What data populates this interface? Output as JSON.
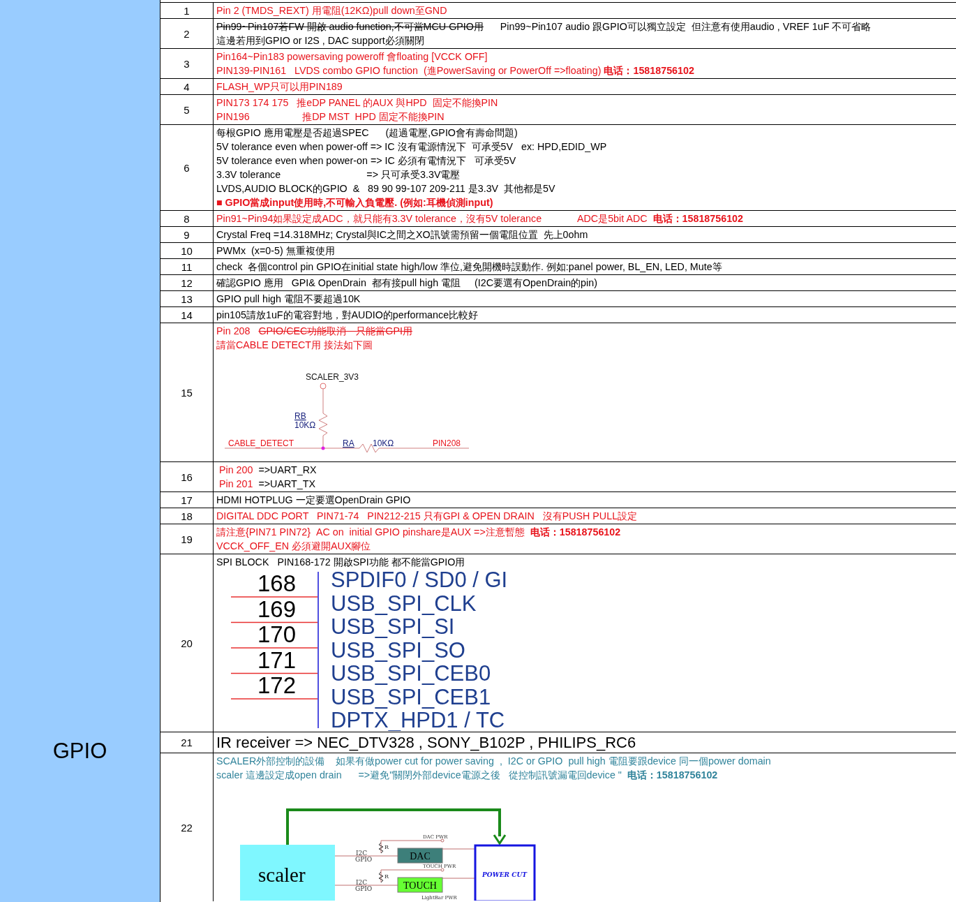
{
  "sidebar": {
    "label": "GPIO"
  },
  "rows": [
    {
      "no": "1",
      "kind": "text",
      "lines": [
        {
          "bold": false,
          "parts": [
            {
              "text": "Pin 2 (TMDS_REXT) 用電阻(12KΩ)pull down至GND",
              "color": "#e8141c",
              "struck": false
            }
          ]
        }
      ]
    },
    {
      "no": "2",
      "kind": "text",
      "lines": [
        {
          "bold": false,
          "parts": [
            {
              "text": "Pin99~Pin107若FW 開啟 audio function,不可當MCU GPIO用",
              "color": "#000000",
              "struck": true
            },
            {
              "text": "      Pin99~Pin107 audio 跟GPIO可以獨立設定  但注意有使用audio , VREF 1uF 不可省略",
              "color": "#000000",
              "struck": false
            }
          ]
        },
        {
          "bold": false,
          "parts": [
            {
              "text": "這邊若用到GPIO or I2S , DAC support必須關閉",
              "color": "#000000",
              "struck": false
            }
          ]
        }
      ]
    },
    {
      "no": "3",
      "kind": "text",
      "lines": [
        {
          "bold": false,
          "parts": [
            {
              "text": "Pin164~Pin183 powersaving poweroff 會floating [VCCK OFF]",
              "color": "#e8141c",
              "struck": false
            }
          ]
        },
        {
          "bold": false,
          "parts": [
            {
              "text": "PIN139-PIN161   LVDS combo GPIO function  (進PowerSaving or PowerOff =>floating) **电话：15818756102**",
              "color": "#e8141c",
              "struck": false
            }
          ]
        }
      ]
    },
    {
      "no": "4",
      "kind": "text",
      "lines": [
        {
          "bold": false,
          "parts": [
            {
              "text": "FLASH_WP只可以用PIN189",
              "color": "#e8141c",
              "struck": false
            }
          ]
        }
      ]
    },
    {
      "no": "5",
      "kind": "text",
      "lines": [
        {
          "bold": false,
          "parts": [
            {
              "text": "PIN173 174 175   推eDP PANEL 的AUX 與HPD  固定不能換PIN",
              "color": "#e8141c",
              "struck": false
            }
          ]
        },
        {
          "bold": false,
          "parts": [
            {
              "text": "PIN196                   推DP MST  HPD 固定不能換PIN",
              "color": "#e8141c",
              "struck": false
            }
          ]
        }
      ]
    },
    {
      "no": "6",
      "kind": "text",
      "lines": [
        {
          "bold": false,
          "parts": [
            {
              "text": "每根GPIO 應用電壓是否超過SPEC      (超過電壓,GPIO會有壽命問題)",
              "color": "#000000",
              "struck": false
            }
          ]
        },
        {
          "bold": false,
          "parts": [
            {
              "text": "5V tolerance even when power-off => IC 沒有電源情況下  可承受5V   ex: HPD,EDID_WP",
              "color": "#000000",
              "struck": false
            }
          ]
        },
        {
          "bold": false,
          "parts": [
            {
              "text": "5V tolerance even when power-on => IC 必須有電情況下   可承受5V",
              "color": "#000000",
              "struck": false
            }
          ]
        },
        {
          "bold": false,
          "parts": [
            {
              "text": "3.3V tolerance                               => 只可承受3.3V電壓",
              "color": "#000000",
              "struck": false
            }
          ]
        },
        {
          "bold": false,
          "parts": [
            {
              "text": "LVDS,AUDIO BLOCK的GPIO  &   89 90 99-107 209-211 是3.3V  其他都是5V",
              "color": "#000000",
              "struck": false
            }
          ]
        },
        {
          "bold": true,
          "parts": [
            {
              "text": "■ GPIO當成input使用時,不可輸入負電壓. (例如:耳機偵測input)",
              "color": "#e8141c",
              "struck": false
            }
          ]
        }
      ]
    },
    {
      "no": "8",
      "kind": "text",
      "lines": [
        {
          "bold": false,
          "parts": [
            {
              "text": "Pin91~Pin94如果設定成ADC，就只能有3.3V tolerance，沒有5V tolerance             ADC是5bit ADC  **电话：15818756102**",
              "color": "#e8141c",
              "struck": false
            }
          ]
        }
      ]
    },
    {
      "no": "9",
      "kind": "text",
      "lines": [
        {
          "bold": false,
          "parts": [
            {
              "text": "Crystal Freq =14.318MHz; Crystal與IC之間之XO訊號需預留一個電阻位置  先上0ohm",
              "color": "#000000",
              "struck": false
            }
          ]
        }
      ]
    },
    {
      "no": "10",
      "kind": "text",
      "lines": [
        {
          "bold": false,
          "parts": [
            {
              "text": "PWMx  (x=0-5) 無重複使用",
              "color": "#000000",
              "struck": false
            }
          ]
        }
      ]
    },
    {
      "no": "11",
      "kind": "text",
      "lines": [
        {
          "bold": false,
          "parts": [
            {
              "text": "check  各個control pin GPIO在initial state high/low 準位,避免開機時誤動作. 例如:panel power, BL_EN, LED, Mute等",
              "color": "#000000",
              "struck": false
            }
          ]
        }
      ]
    },
    {
      "no": "12",
      "kind": "text",
      "lines": [
        {
          "bold": false,
          "parts": [
            {
              "text": "確認GPIO 應用   GPI& OpenDrain  都有接pull high 電阻     (I2C要選有OpenDrain的pin)",
              "color": "#000000",
              "struck": false
            }
          ]
        }
      ]
    },
    {
      "no": "13",
      "kind": "text",
      "lines": [
        {
          "bold": false,
          "parts": [
            {
              "text": "GPIO pull high 電阻不要超過10K",
              "color": "#000000",
              "struck": false
            }
          ]
        }
      ]
    },
    {
      "no": "14",
      "kind": "text",
      "lines": [
        {
          "bold": false,
          "parts": [
            {
              "text": "pin105請放1uF的電容對地，對AUDIO的performance比較好",
              "color": "#000000",
              "struck": false
            }
          ]
        }
      ]
    },
    {
      "no": "15",
      "kind": "cable-detect",
      "lines": [
        {
          "bold": false,
          "parts": [
            {
              "text": "Pin 208   ",
              "color": "#e8141c",
              "struck": false
            },
            {
              "text": "GPIO/CEC功能取消　只能當GPI用",
              "color": "#e8141c",
              "struck": true
            }
          ]
        },
        {
          "bold": false,
          "parts": [
            {
              "text": "請當CABLE DETECT用 接法如下圖",
              "color": "#e8141c",
              "struck": false
            }
          ]
        }
      ],
      "figure": {
        "supply": "SCALER_3V3",
        "rb_name": "RB",
        "rb_value": "10KΩ",
        "net": "CABLE_DETECT",
        "ra_name": "RA",
        "ra_value": "10KΩ",
        "pin": "PIN208"
      }
    },
    {
      "no": "16",
      "kind": "text",
      "lines": [
        {
          "bold": false,
          "parts": [
            {
              "text": " Pin 200",
              "color": "#e8141c",
              "struck": false
            },
            {
              "text": "  =>UART_RX",
              "color": "#000000",
              "struck": false
            }
          ]
        },
        {
          "bold": false,
          "parts": [
            {
              "text": " Pin 201",
              "color": "#e8141c",
              "struck": false
            },
            {
              "text": "  =>UART_TX",
              "color": "#000000",
              "struck": false
            }
          ]
        }
      ]
    },
    {
      "no": "17",
      "kind": "text",
      "lines": [
        {
          "bold": false,
          "parts": [
            {
              "text": "HDMI HOTPLUG 一定要選OpenDrain GPIO",
              "color": "#000000",
              "struck": false
            }
          ]
        }
      ]
    },
    {
      "no": "18",
      "kind": "text",
      "lines": [
        {
          "bold": false,
          "parts": [
            {
              "text": "DIGITAL DDC PORT   PIN71-74   PIN212-215 只有GPI & OPEN DRAIN   沒有PUSH PULL設定",
              "color": "#e8141c",
              "struck": false
            }
          ]
        }
      ]
    },
    {
      "no": "19",
      "kind": "text",
      "lines": [
        {
          "bold": false,
          "parts": [
            {
              "text": "請注意{PIN71 PIN72}  AC on  initial GPIO pinshare是AUX =>注意暫態  **电话：15818756102**",
              "color": "#e8141c",
              "struck": false
            }
          ]
        },
        {
          "bold": false,
          "parts": [
            {
              "text": "VCCK_OFF_EN 必須避開AUX腳位",
              "color": "#e8141c",
              "struck": false
            }
          ]
        }
      ]
    },
    {
      "no": "20",
      "kind": "spi-pins",
      "lines": [
        {
          "bold": false,
          "parts": [
            {
              "text": "SPI BLOCK   PIN168-172 開啟SPI功能 都不能當GPIO用",
              "color": "#000000",
              "struck": false
            }
          ]
        }
      ],
      "figure": {
        "pins": [
          "168",
          "169",
          "170",
          "171",
          "172"
        ],
        "signals": [
          "SPDIF0 / SD0 /  GI",
          "USB_SPI_CLK",
          "USB_SPI_SI",
          "USB_SPI_SO",
          "USB_SPI_CEB0",
          "USB_SPI_CEB1",
          "DPTX_HPD1 / TC"
        ]
      }
    },
    {
      "no": "21",
      "kind": "large-text",
      "lines": [
        {
          "bold": false,
          "parts": [
            {
              "text": "IR receiver => NEC_DTV328 , SONY_B102P , PHILIPS_RC6",
              "color": "#000000",
              "struck": false
            }
          ]
        }
      ]
    },
    {
      "no": "22",
      "kind": "power-cut",
      "lines": [
        {
          "bold": false,
          "parts": [
            {
              "text": "SCALER外部控制的設備    如果有做power cut for power saving  ,  I2C or GPIO  pull high 電阻要跟device 同一個power domain",
              "color": "#31849b",
              "struck": false
            }
          ]
        },
        {
          "bold": false,
          "parts": [
            {
              "text": "scaler 這邊設定成open drain      =>避免\"關閉外部device電源之後   從控制訊號漏電回device \"  **电话：15818756102**",
              "color": "#31849b",
              "struck": false
            }
          ]
        }
      ],
      "figure": {
        "source": "scaler",
        "target": "POWER CUT",
        "devices": [
          {
            "label": "DAC",
            "color": "#3d7f7a",
            "supply": "DAC PWR",
            "resistor": "R",
            "bus": "I2C",
            "io": "GPIO"
          },
          {
            "label": "TOUCH",
            "color": "#66ff33",
            "supply": "TOUCH PWR",
            "resistor": "R",
            "bus": "I2C",
            "io": "GPIO"
          }
        ],
        "extra_supply": "LightBar PWR"
      }
    }
  ]
}
